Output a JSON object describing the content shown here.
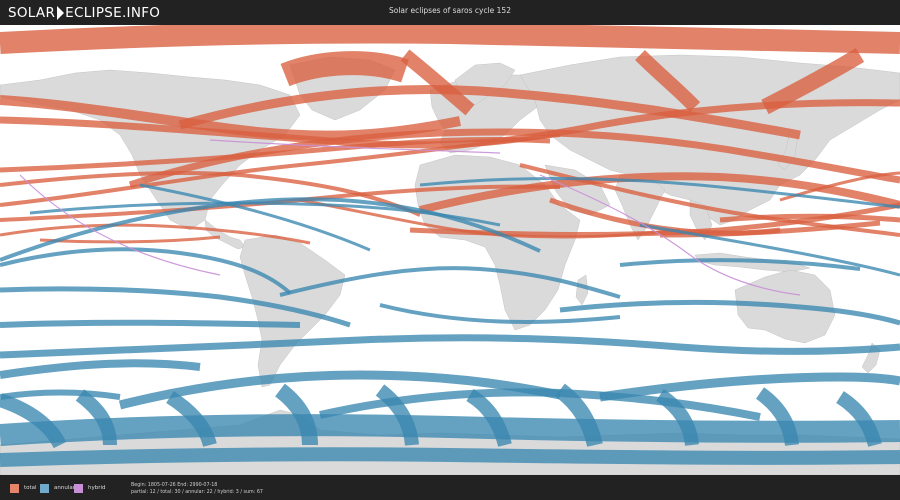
{
  "header": {
    "logo_left": "SOLAR",
    "logo_right": "ECLIPSE.INFO",
    "title": "Solar eclipses of saros cycle 152"
  },
  "colors": {
    "background_bar": "#222222",
    "land": "#dadada",
    "ocean": "#ffffff",
    "total": "#d95f3f",
    "annular": "#3a86b0",
    "hybrid": "#c98fd6"
  },
  "legend": [
    {
      "label": "total",
      "color": "#e6846a"
    },
    {
      "label": "annular",
      "color": "#6fa9cb"
    },
    {
      "label": "hybrid",
      "color": "#c98fd6"
    }
  ],
  "info": {
    "line1": "Begin: 1805-07-26 End: 2990-07-18",
    "line2": "partial: 12 / total: 30 / annular: 22 / hybrid: 3 / sum: 67"
  },
  "map": {
    "projection": "equirectangular",
    "layer_kinds": [
      "land",
      "total-paths",
      "annular-paths",
      "hybrid-paths"
    ]
  }
}
